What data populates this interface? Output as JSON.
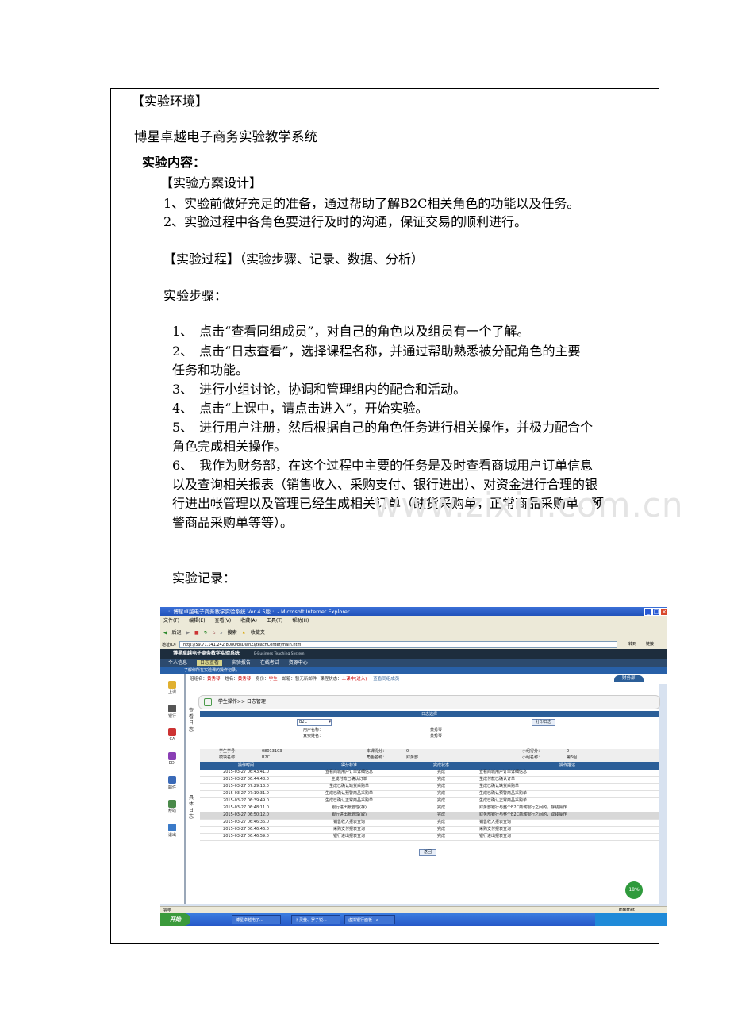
{
  "header": {
    "env_heading": "【实验环境】",
    "env_value": "博星卓越电子商务实验教学系统"
  },
  "content": {
    "heading": "实验内容：",
    "design_heading": "【实验方案设计】",
    "design_items": [
      "1、实验前做好充足的准备，通过帮助了解B2C相关角色的功能以及任务。",
      "2、实验过程中各角色要进行及时的沟通，保证交易的顺利进行。"
    ],
    "process_heading": "【实验过程】（实验步骤、记录、数据、分析）",
    "steps_heading": "实验步骤：",
    "steps": [
      "1、　点击“查看同组成员”，对自己的角色以及组员有一个了解。",
      "2、　点击“日志查看”，选择课程名称，并通过帮助熟悉被分配角色的主要",
      "任务和功能。",
      "3、　进行小组讨论，协调和管理组内的配合和活动。",
      "4、　点击“上课中，请点击进入”，开始实验。",
      "5、　进行用户注册，然后根据自己的角色任务进行相关操作，并极力配合个",
      "角色完成相关操作。",
      "6、　我作为财务部，在这个过程中主要的任务是及时查看商城用户订单信息",
      "以及查询相关报表（销售收入、采购支付、银行进出）、对资金进行合理的银",
      "行进出帐管理以及管理已经生成相关订单（缺货采购单，正常商品采购单、预",
      "警商品采购单等等）。"
    ],
    "record_heading": "实验记录：",
    "watermark": "www.zixin.com.cn"
  },
  "screenshot": {
    "window_title": ":: 博星卓越电子商务教学实验系统 Ver 4.5版 :: - Microsoft Internet Explorer",
    "menu": [
      "文件(F)",
      "编辑(E)",
      "查看(V)",
      "收藏(A)",
      "工具(T)",
      "帮助(H)"
    ],
    "toolbar": [
      "后退",
      "搜索",
      "收藏夹"
    ],
    "address_label": "地址(D)",
    "address": "http://59.71.141.242:8080/bsDianZi/teachCenter/main.htm",
    "go_label": "转到",
    "links_label": "链接",
    "app_title": "博星卓越电子商务教学实验系统",
    "app_subtitle": "E-Business Teaching System",
    "nav": [
      "个人信息",
      "日志查看",
      "实验报告",
      "在线考试",
      "资源中心"
    ],
    "notice": "了解你所在实验课的操作记录。",
    "info": {
      "group_label": "组组名：",
      "group": "黄秀琴",
      "name_label": "姓名：",
      "name": "黄秀琴",
      "role_label": "身份：",
      "role": "学生",
      "mail_label": "邮箱：",
      "mail": "暂无新邮件",
      "course_label": "课程状态：",
      "course": "上课中(进入)",
      "members": "查看同组成员",
      "right_tab": "财务部"
    },
    "side": [
      "上课",
      "银行",
      "CA",
      "EDI",
      "邮件",
      "帮助",
      "退出"
    ],
    "vtab1": "查看日志",
    "vtab2": "具体日志",
    "breadcrumb": "学生操作>> 日志管理",
    "select_header": "日志选择",
    "select_value": "B2C",
    "print_button": "打印日志",
    "user_label": "用户名称：",
    "user_value": "黄秀琴",
    "real_label": "真实姓名：",
    "real_value": "黄秀琴",
    "stu_no_label": "学生学号：",
    "stu_no": "08013103",
    "score_label": "本课得分：",
    "score": "0",
    "group_score_label": "小组得分：",
    "group_score": "0",
    "module_label": "模块名称：",
    "module": "B2C",
    "role_name_label": "角色名称：",
    "role_name": "财务部",
    "group_name_label": "小组名称：",
    "group_name": "第6组",
    "table_headers": [
      "操作时间",
      "得分标准",
      "完成状态",
      "操作描述"
    ],
    "rows": [
      [
        "2015-03-27 06:43:41.0",
        "查看商城用户订单详细信息",
        "完成",
        "查看商城用户订单详细信息"
      ],
      [
        "2015-03-27 06:44:48.0",
        "生成付款已确认订单",
        "完成",
        "生成付款已确认订单"
      ],
      [
        "2015-03-27 07:29:13.0",
        "生成已确认缺货采购单",
        "完成",
        "生成已确认缺货采购单"
      ],
      [
        "2015-03-27 07:19:31.0",
        "生成已确认预警商品采购单",
        "完成",
        "生成已确认预警商品采购单"
      ],
      [
        "2015-03-27 06:39:49.0",
        "生成已确认正常商品采购单",
        "完成",
        "生成已确认正常商品采购单"
      ],
      [
        "2015-03-27 06:48:11.0",
        "银行进出帐管理(存)",
        "完成",
        "财务部银行与整个B2C商城银行之间的，存钱操作"
      ],
      [
        "2015-03-27 06:50:12.0",
        "银行进出帐管理(取)",
        "完成",
        "财务部银行与整个B2C商城银行之间的，取钱操作"
      ],
      [
        "2015-03-27 06:46:36.0",
        "销售收入报表查询",
        "完成",
        "销售收入报表查询"
      ],
      [
        "2015-03-27 06:46:46.0",
        "采购支付报表查询",
        "完成",
        "采购支付报表查询"
      ],
      [
        "2015-03-27 06:46:59.0",
        "银行进出报表查询",
        "完成",
        "银行进出报表查询"
      ]
    ],
    "back_button": "返回",
    "badge": "18%",
    "status_left": "完毕",
    "status_right": "Internet",
    "start": "开始",
    "tasks": [
      "博星卓越电子...",
      "卜灵莹、罗子锐...",
      "虚拟银行面板 - a"
    ]
  }
}
